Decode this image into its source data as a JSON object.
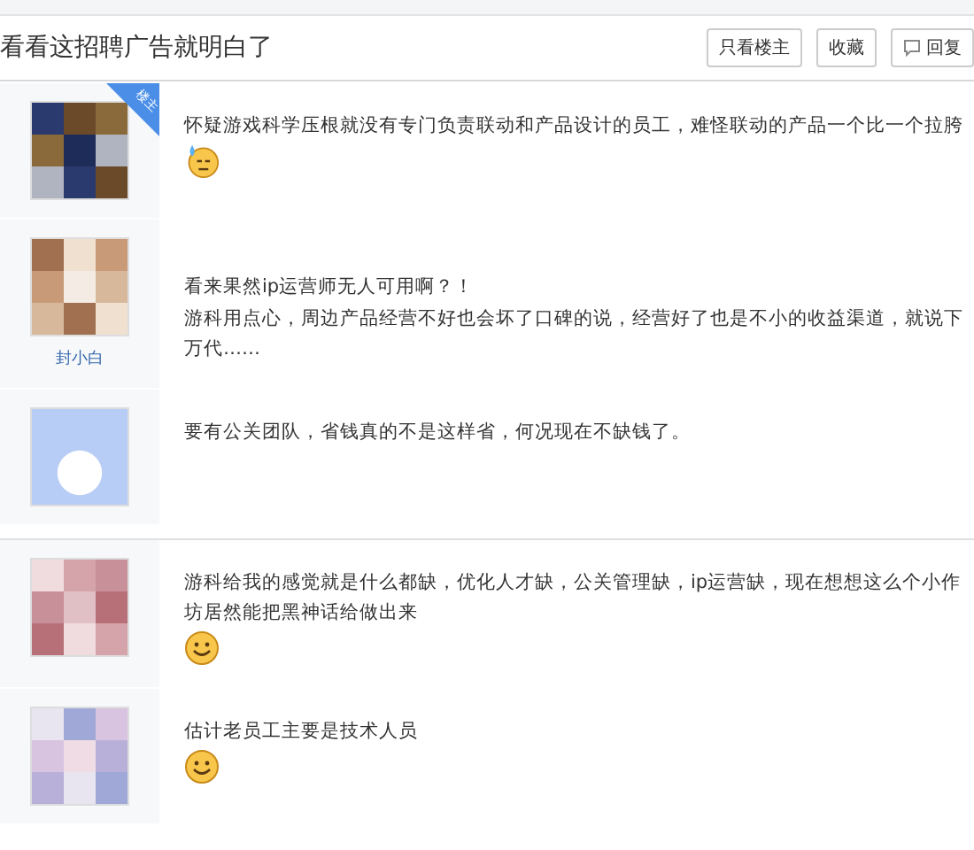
{
  "header": {
    "title": "看看这招聘广告就明白了",
    "buttons": [
      {
        "label": "只看楼主",
        "kind": "plain"
      },
      {
        "label": "收藏",
        "kind": "plain"
      },
      {
        "label": "回复",
        "kind": "reply"
      }
    ]
  },
  "posts": [
    {
      "avatar": {
        "kind": "picture"
      },
      "badge": "楼主",
      "paragraphs": [
        "怀疑游戏科学压根就没有专门负责联动和产品设计的员工，难怪联动的产品一个比一个拉胯"
      ],
      "emoji": {
        "kind": "sweat"
      },
      "section_start": false
    },
    {
      "avatar": {
        "kind": "picture"
      },
      "username": "封小白",
      "paragraphs": [
        "看来果然ip运营师无人可用啊？！",
        "游科用点心，周边产品经营不好也会坏了口碑的说，经营好了也是不小的收益渠道，就说下万代……"
      ],
      "section_start": false
    },
    {
      "avatar": {
        "kind": "default"
      },
      "paragraphs": [
        "要有公关团队，省钱真的不是这样省，何况现在不缺钱了。"
      ],
      "section_start": false
    },
    {
      "avatar": {
        "kind": "picture"
      },
      "paragraphs": [
        "游科给我的感觉就是什么都缺，优化人才缺，公关管理缺，ip运营缺，现在想想这么个小作坊居然能把黑神话给做出来"
      ],
      "emoji": {
        "kind": "smile"
      },
      "section_start": true
    },
    {
      "avatar": {
        "kind": "picture"
      },
      "paragraphs": [
        "估计老员工主要是技术人员"
      ],
      "emoji": {
        "kind": "smile"
      },
      "section_start": false
    }
  ]
}
